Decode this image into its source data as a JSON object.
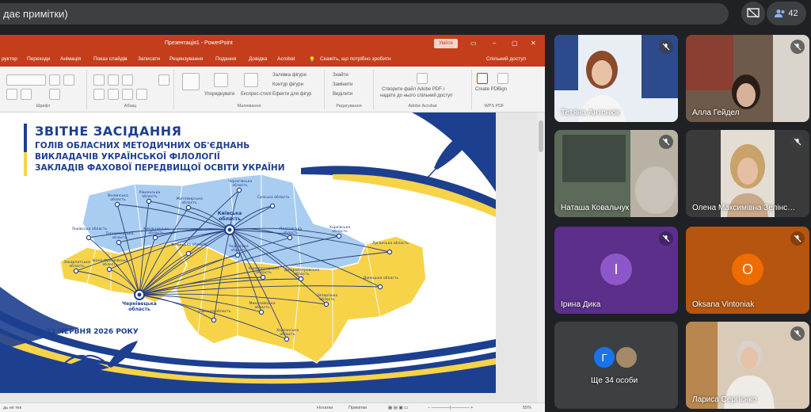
{
  "meet": {
    "presenter_text": "дає примітки)",
    "participant_count": "42"
  },
  "ppt": {
    "window_title": "Презентація1 - PowerPoint",
    "sign_in": "Увійти",
    "menu": [
      "руктор",
      "Переходи",
      "Анімація",
      "Показ слайдів",
      "Записати",
      "Рецензування",
      "Подання",
      "Довідка",
      "Acrobat",
      "Скажіть, що потрібно зробити",
      "Спільний доступ"
    ],
    "ribbon": {
      "font_group": "Шрифт",
      "paragraph_group": "Абзац",
      "drawing_group": "Малювання",
      "editing_group": "Редагування",
      "acrobat_group": "Adobe Acrobat",
      "wps_group": "WPS PDF",
      "arrange": "Упорядкувати",
      "quick_styles": "Експрес-стилі",
      "shape_fill": "Заливка фігури",
      "shape_outline": "Контур фігури",
      "shape_effects": "Ефекти для фігур",
      "find": "Знайти",
      "replace": "Замінити",
      "select": "Виділити",
      "acrobat_line1": "Створити файл Adobe PDF і",
      "acrobat_line2": "надати до нього спільний доступ",
      "create_pdf": "Create PDF",
      "sign": "Sign"
    },
    "status": {
      "slide_info": "дь не тек",
      "notes": "Нотатки",
      "comments": "Примітки",
      "zoom": "55%"
    }
  },
  "slide": {
    "title": "ЗВІТНЕ ЗАСІДАННЯ",
    "line1": "ГОЛІВ ОБЛАСНИХ МЕТОДИЧНИХ ОБ'ЄДНАНЬ",
    "line2": "ВИКЛАДАЧІВ УКРАЇНСЬКОЇ ФІЛОЛОГІЇ",
    "line3": "ЗАКЛАДІВ ФАХОВОЇ ПЕРЕДВИЩОЇ ОСВІТИ УКРАЇНИ",
    "date": "11 ЧЕРВНЯ 2026 РОКУ",
    "hub_kyiv": "Київська область",
    "hub_chernivtsi": "Чернівецька область",
    "regions": [
      "Волинська область",
      "Рівненська область",
      "Житомирська область",
      "Чернігівська область",
      "Сумська область",
      "Львівська область",
      "Тернопільська область",
      "Хмельницька область",
      "Полтавська область",
      "Харківська область",
      "Закарпатська область",
      "Івано-Франківська область",
      "Вінницька область",
      "Черкаська область",
      "Кіровоградська область",
      "Дніпропетровська область",
      "Луганська область",
      "Донецька область",
      "Одеська область",
      "Миколаївська область",
      "Запорізька область",
      "Херсонська область"
    ]
  },
  "tiles": [
    {
      "name": "Тетяна Антонюк"
    },
    {
      "name": "Алла Гейдел"
    },
    {
      "name": "Наташа Ковальчук"
    },
    {
      "name": "Олена Максимівна Зелінс…"
    },
    {
      "name": "Ірина Дика",
      "initial": "І"
    },
    {
      "name": "Oksana Vintoniak",
      "initial": "O"
    },
    {
      "name": "Ще 34 особи",
      "initial": "Г"
    },
    {
      "name": "Лариса Сергієнко"
    }
  ],
  "colors": {
    "ppt_accent": "#c43e1c",
    "meet_bg": "#202124",
    "tile_bg": "#3c4043",
    "slide_blue": "#1d3f8f",
    "ukraine_yellow": "#f7d34a",
    "ukraine_blue": "#a9cdf0",
    "irina_tile": "#5b2f8a",
    "oksana_tile": "#b5550f"
  }
}
